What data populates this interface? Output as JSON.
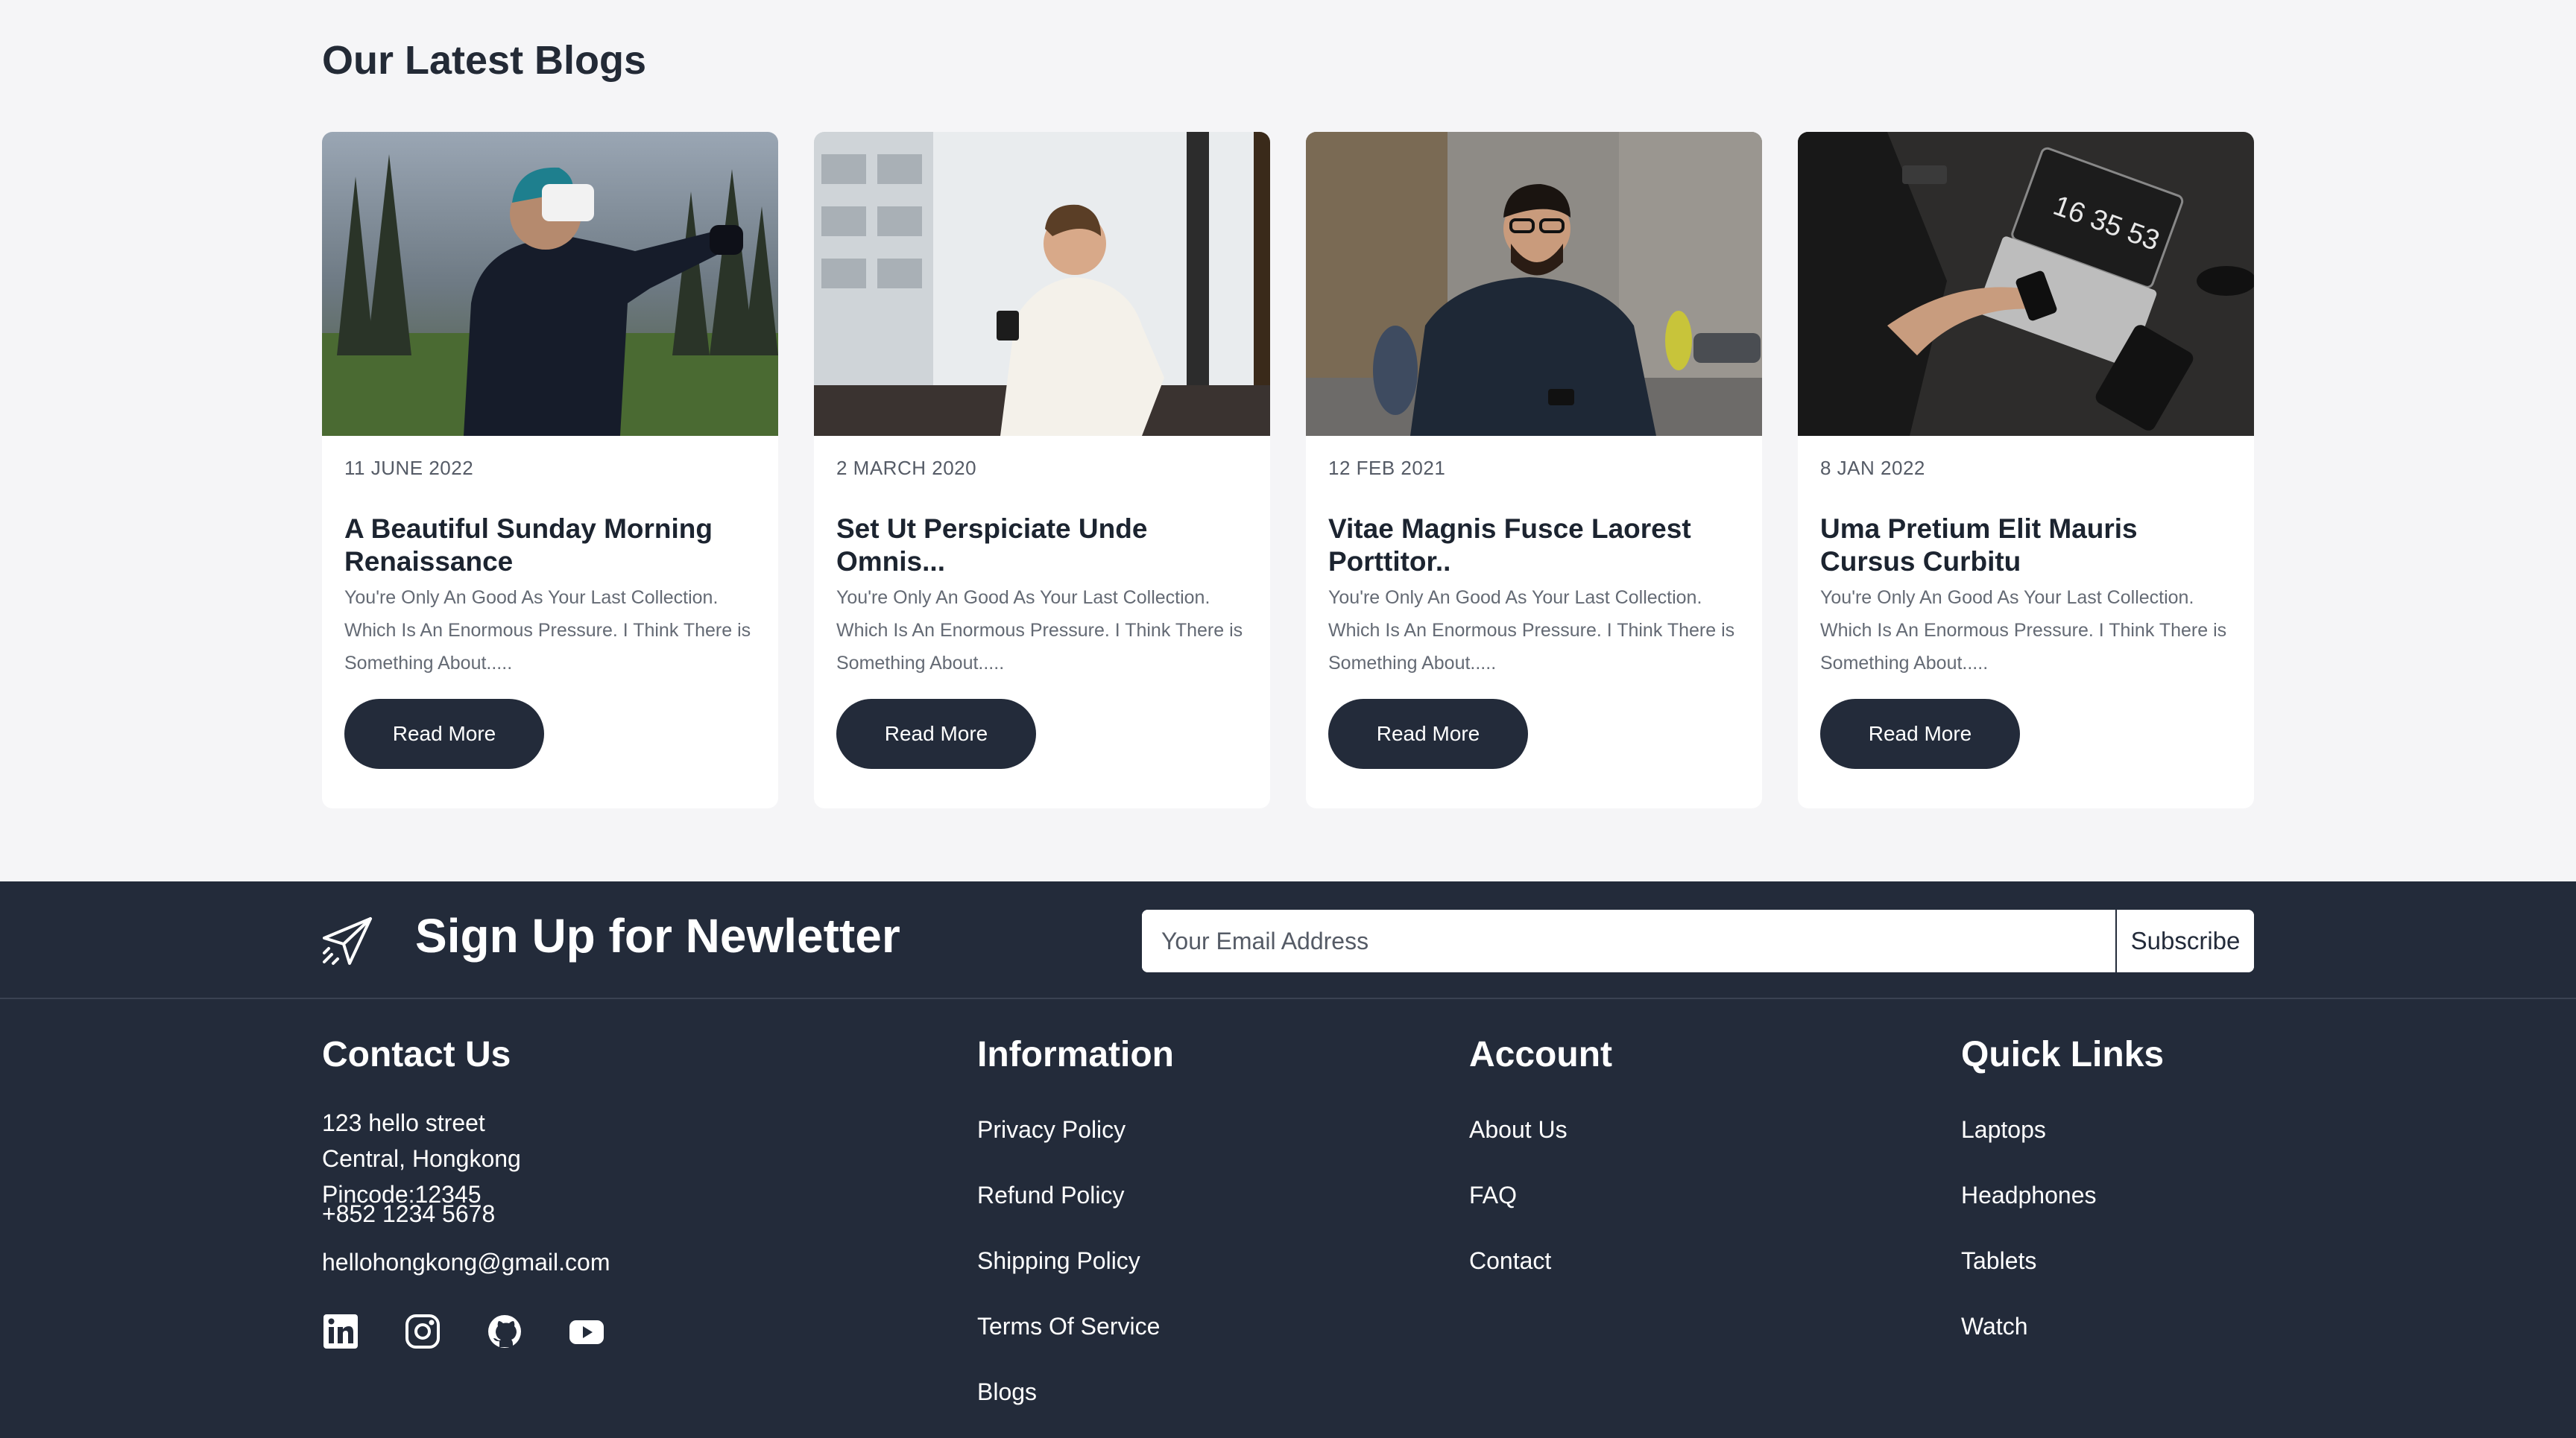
{
  "blogs": {
    "title": "Our Latest Blogs",
    "cards": [
      {
        "image": "man-with-vr-headset-in-forest",
        "date": "11 JUNE 2022",
        "title": "A Beautiful Sunday Morning Renaissance",
        "excerpt": "You're Only An Good As Your Last Collection. Which Is An Enormous Pressure. I Think There is Something About.....",
        "button": "Read More"
      },
      {
        "image": "man-in-white-shirt-using-phone-at-window",
        "date": "2 MARCH 2020",
        "title": "Set Ut Perspiciate Unde Omnis...",
        "excerpt": "You're Only An Good As Your Last Collection. Which Is An Enormous Pressure. I Think There is Something About.....",
        "button": "Read More"
      },
      {
        "image": "man-with-glasses-using-phone-on-street",
        "date": "12 FEB 2021",
        "title": "Vitae Magnis Fusce Laorest Porttitor..",
        "excerpt": "You're Only An Good As Your Last Collection. Which Is An Enormous Pressure. I Think There is Something About.....",
        "button": "Read More"
      },
      {
        "image": "laptop-phone-on-desk-top-view",
        "image_text": "16 35 53",
        "date": "8 JAN 2022",
        "title": "Uma Pretium Elit Mauris Cursus Curbitu",
        "excerpt": "You're Only An Good As Your Last Collection. Which Is An Enormous Pressure. I Think There is Something About.....",
        "button": "Read More"
      }
    ]
  },
  "newsletter": {
    "icon": "paper-plane-icon",
    "title": "Sign Up for Newletter",
    "email_placeholder": "Your Email Address",
    "subscribe_label": "Subscribe"
  },
  "footer": {
    "contact": {
      "title": "Contact Us",
      "address_line1": "123 hello street",
      "address_line2": "Central, Hongkong",
      "address_line3": "Pincode:12345",
      "phone": "+852 1234 5678",
      "email": "hellohongkong@gmail.com",
      "socials": [
        "linkedin-icon",
        "instagram-icon",
        "github-icon",
        "youtube-icon"
      ]
    },
    "information": {
      "title": "Information",
      "links": [
        "Privacy Policy",
        "Refund Policy",
        "Shipping Policy",
        "Terms Of Service",
        "Blogs"
      ]
    },
    "account": {
      "title": "Account",
      "links": [
        "About Us",
        "FAQ",
        "Contact"
      ]
    },
    "quick_links": {
      "title": "Quick Links",
      "links": [
        "Laptops",
        "Headphones",
        "Tablets",
        "Watch"
      ]
    }
  },
  "colors": {
    "page_bg": "#f5f5f7",
    "footer_bg": "#232b3a",
    "button_bg": "#232b3a",
    "heading": "#232a36"
  }
}
